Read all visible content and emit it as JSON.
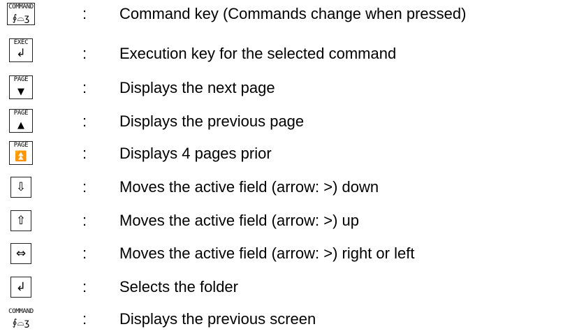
{
  "rows": [
    {
      "key_label": "COMMAND",
      "key_glyph": "∮⌓ʒ",
      "icon": "command-key-icon",
      "colon": ":",
      "description": "Command key (Commands change when pressed)"
    },
    {
      "key_label": "EXEC",
      "key_glyph": "↲",
      "icon": "exec-enter-icon",
      "colon": ":",
      "description": "Execution key for the selected command"
    },
    {
      "key_label": "PAGE",
      "key_glyph": "▼",
      "icon": "page-down-icon",
      "colon": ":",
      "description": "Displays the next page"
    },
    {
      "key_label": "PAGE",
      "key_glyph": "▲",
      "icon": "page-up-icon",
      "colon": ":",
      "description": "Displays the previous page"
    },
    {
      "key_label": "PAGE",
      "key_glyph": "⏫",
      "icon": "page-double-up-icon",
      "colon": ":",
      "description": "Displays 4 pages prior"
    },
    {
      "key_glyph": "⇩",
      "icon": "arrow-down-icon",
      "colon": ":",
      "description": "Moves the active field (arrow: >) down"
    },
    {
      "key_glyph": "⇧",
      "icon": "arrow-up-icon",
      "colon": ":",
      "description": "Moves the active field (arrow: >) up"
    },
    {
      "key_glyph": "⇔",
      "icon": "arrow-left-right-icon",
      "colon": ":",
      "description": "Moves the active field (arrow: >) right or left"
    },
    {
      "key_glyph": "↲",
      "icon": "enter-icon",
      "colon": ":",
      "description": "Selects the folder"
    },
    {
      "key_label": "COMMAND",
      "key_glyph": "∮⌓ʒ",
      "icon": "command-key-icon",
      "colon": ":",
      "description": "Displays the previous screen"
    }
  ]
}
